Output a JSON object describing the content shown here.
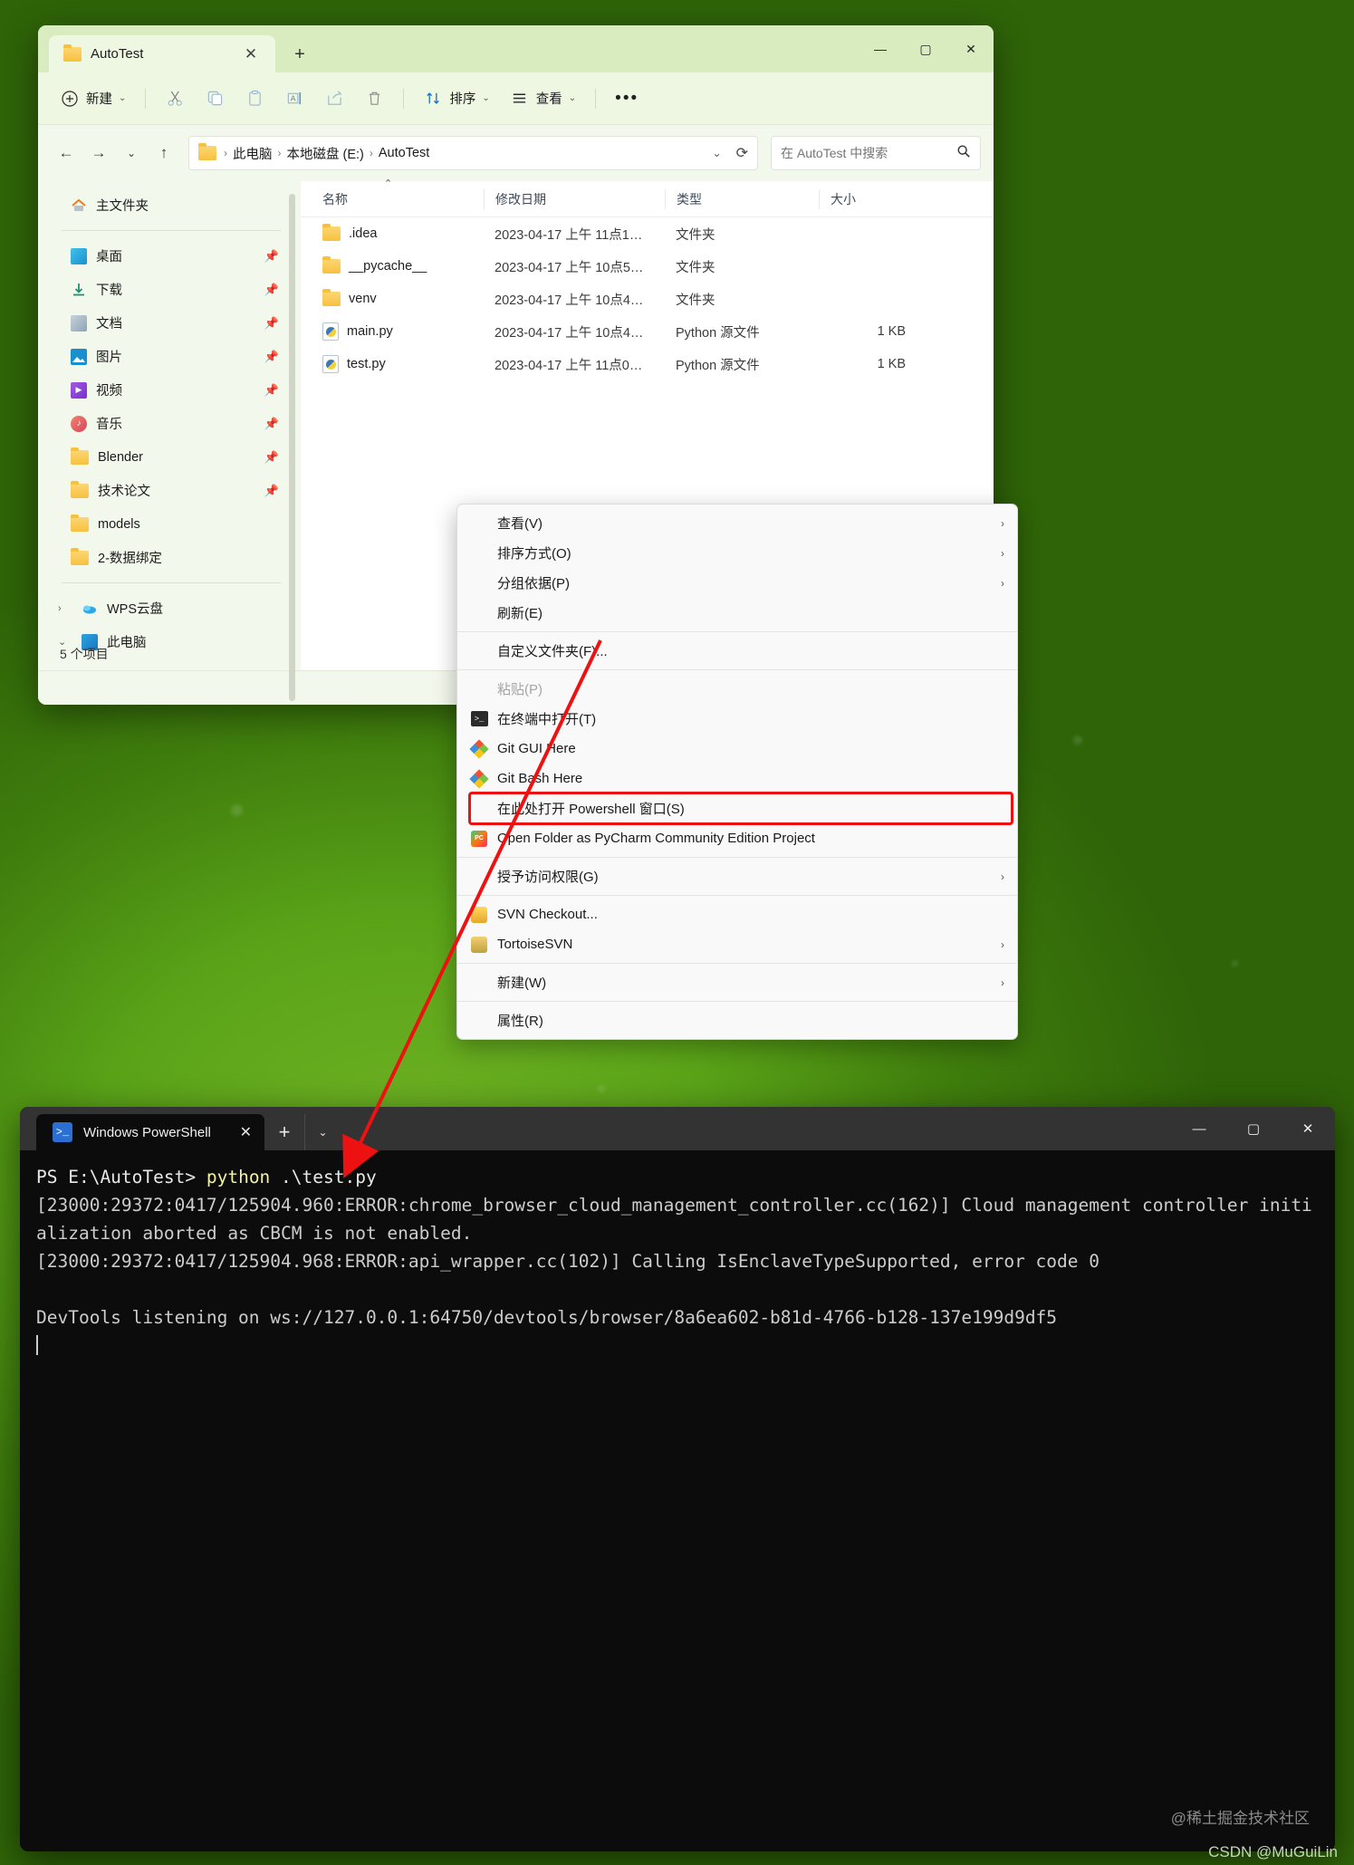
{
  "explorer": {
    "tab": {
      "title": "AutoTest",
      "close_label": "✕",
      "new_tab_label": "+"
    },
    "window_controls": {
      "minimize": "—",
      "maximize": "▢",
      "close": "✕"
    },
    "toolbar": {
      "new_label": "新建",
      "cut_icon": "scissors-icon",
      "copy_icon": "copy-icon",
      "paste_icon": "paste-icon",
      "rename_icon": "rename-icon",
      "share_icon": "share-icon",
      "delete_icon": "trash-icon",
      "sort_label": "排序",
      "view_label": "查看",
      "more_label": "•••"
    },
    "address": {
      "back": "←",
      "forward": "→",
      "recent": "⌄",
      "up": "↑",
      "crumbs": [
        "此电脑",
        "本地磁盘 (E:)",
        "AutoTest"
      ],
      "separator": "›",
      "dropdown": "⌄",
      "refresh": "⟳"
    },
    "search": {
      "placeholder": "在 AutoTest 中搜索",
      "icon": "search-icon"
    },
    "sidebar": {
      "home": {
        "label": "主文件夹",
        "icon": "home-icon"
      },
      "quick": [
        {
          "label": "桌面",
          "icon": "desktop-icon",
          "pinned": true
        },
        {
          "label": "下载",
          "icon": "download-icon",
          "pinned": true
        },
        {
          "label": "文档",
          "icon": "document-icon",
          "pinned": true
        },
        {
          "label": "图片",
          "icon": "pictures-icon",
          "pinned": true
        },
        {
          "label": "视频",
          "icon": "videos-icon",
          "pinned": true
        },
        {
          "label": "音乐",
          "icon": "music-icon",
          "pinned": true
        },
        {
          "label": "Blender",
          "icon": "folder-icon",
          "pinned": true
        },
        {
          "label": "技术论文",
          "icon": "folder-icon",
          "pinned": true
        },
        {
          "label": "models",
          "icon": "folder-icon",
          "pinned": false
        },
        {
          "label": "2-数据绑定",
          "icon": "folder-icon",
          "pinned": false
        }
      ],
      "trees": [
        {
          "label": "WPS云盘",
          "icon": "cloud-icon",
          "expander": "›"
        },
        {
          "label": "此电脑",
          "icon": "monitor-icon",
          "expander": "⌄"
        }
      ],
      "status": "5 个项目"
    },
    "columns": [
      "名称",
      "修改日期",
      "类型",
      "大小"
    ],
    "rows": [
      {
        "name": ".idea",
        "icon": "folder-icon",
        "date": "2023-04-17 上午 11点1…",
        "type": "文件夹",
        "size": ""
      },
      {
        "name": "__pycache__",
        "icon": "folder-icon",
        "date": "2023-04-17 上午 10点5…",
        "type": "文件夹",
        "size": ""
      },
      {
        "name": "venv",
        "icon": "folder-icon",
        "date": "2023-04-17 上午 10点4…",
        "type": "文件夹",
        "size": ""
      },
      {
        "name": "main.py",
        "icon": "python-icon",
        "date": "2023-04-17 上午 10点4…",
        "type": "Python 源文件",
        "size": "1 KB"
      },
      {
        "name": "test.py",
        "icon": "python-icon",
        "date": "2023-04-17 上午 11点0…",
        "type": "Python 源文件",
        "size": "1 KB"
      }
    ],
    "view_buttons": {
      "details": "details-view-icon",
      "pane": "preview-pane-icon"
    }
  },
  "context_menu": {
    "items": [
      {
        "label": "查看(V)",
        "icon": "",
        "arrow": "›",
        "sep_after": false,
        "disabled": false,
        "highlight": false
      },
      {
        "label": "排序方式(O)",
        "icon": "",
        "arrow": "›",
        "sep_after": false,
        "disabled": false,
        "highlight": false
      },
      {
        "label": "分组依据(P)",
        "icon": "",
        "arrow": "›",
        "sep_after": false,
        "disabled": false,
        "highlight": false
      },
      {
        "label": "刷新(E)",
        "icon": "",
        "arrow": "",
        "sep_after": true,
        "disabled": false,
        "highlight": false
      },
      {
        "label": "自定义文件夹(F)...",
        "icon": "",
        "arrow": "",
        "sep_after": true,
        "disabled": false,
        "highlight": false
      },
      {
        "label": "粘贴(P)",
        "icon": "",
        "arrow": "",
        "sep_after": false,
        "disabled": true,
        "highlight": false
      },
      {
        "label": "在终端中打开(T)",
        "icon": "terminal-icon",
        "arrow": "",
        "sep_after": false,
        "disabled": false,
        "highlight": false
      },
      {
        "label": "Git GUI Here",
        "icon": "git-icon",
        "arrow": "",
        "sep_after": false,
        "disabled": false,
        "highlight": false
      },
      {
        "label": "Git Bash Here",
        "icon": "git-icon",
        "arrow": "",
        "sep_after": false,
        "disabled": false,
        "highlight": false
      },
      {
        "label": "在此处打开 Powershell 窗口(S)",
        "icon": "",
        "arrow": "",
        "sep_after": false,
        "disabled": false,
        "highlight": true
      },
      {
        "label": "Open Folder as PyCharm Community Edition Project",
        "icon": "pycharm-icon",
        "arrow": "",
        "sep_after": true,
        "disabled": false,
        "highlight": false
      },
      {
        "label": "授予访问权限(G)",
        "icon": "",
        "arrow": "›",
        "sep_after": true,
        "disabled": false,
        "highlight": false
      },
      {
        "label": "SVN Checkout...",
        "icon": "svn-icon",
        "arrow": "",
        "sep_after": false,
        "disabled": false,
        "highlight": false
      },
      {
        "label": "TortoiseSVN",
        "icon": "tortoisesvn-icon",
        "arrow": "›",
        "sep_after": true,
        "disabled": false,
        "highlight": false
      },
      {
        "label": "新建(W)",
        "icon": "",
        "arrow": "›",
        "sep_after": true,
        "disabled": false,
        "highlight": false
      },
      {
        "label": "属性(R)",
        "icon": "",
        "arrow": "",
        "sep_after": false,
        "disabled": false,
        "highlight": false
      }
    ],
    "highlight_color": "#ee1111"
  },
  "powershell": {
    "tab_title": "Windows PowerShell",
    "tab_icon": "powershell-icon",
    "tab_close": "✕",
    "new_tab": "+",
    "dropdown": "⌄",
    "window_controls": {
      "minimize": "—",
      "maximize": "▢",
      "close": "✕"
    },
    "prompt": "PS E:\\AutoTest>",
    "command": "python",
    "command_arg": " .\\test.py",
    "output": "[23000:29372:0417/125904.960:ERROR:chrome_browser_cloud_management_controller.cc(162)] Cloud management controller initialization aborted as CBCM is not enabled.\n[23000:29372:0417/125904.968:ERROR:api_wrapper.cc(102)] Calling IsEnclaveTypeSupported, error code 0\n\nDevTools listening on ws://127.0.0.1:64750/devtools/browser/8a6ea602-b81d-4766-b128-137e199d9df5",
    "watermark": "@稀土掘金技术社区"
  },
  "page_watermark": "CSDN @MuGuiLin"
}
